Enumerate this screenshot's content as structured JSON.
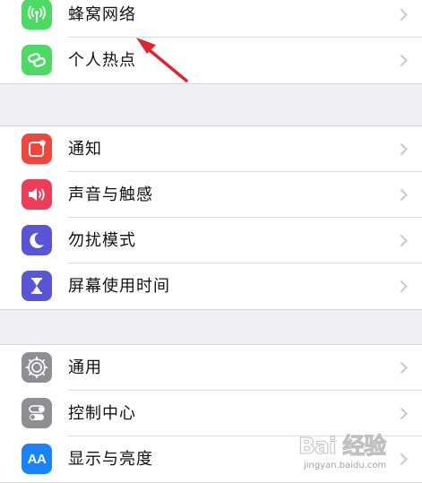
{
  "settings": {
    "group1": [
      {
        "label": "蜂窝网络",
        "icon": "cellular-antenna-icon",
        "color": "#4cd964"
      },
      {
        "label": "个人热点",
        "icon": "personal-hotspot-link-icon",
        "color": "#4cd964"
      }
    ],
    "group2": [
      {
        "label": "通知",
        "icon": "notifications-icon",
        "color": "#f0463c"
      },
      {
        "label": "声音与触感",
        "icon": "speaker-icon",
        "color": "#ee3c5a"
      },
      {
        "label": "勿扰模式",
        "icon": "moon-icon",
        "color": "#5856d6"
      },
      {
        "label": "屏幕使用时间",
        "icon": "hourglass-icon",
        "color": "#5856d6"
      }
    ],
    "group3": [
      {
        "label": "通用",
        "icon": "gear-icon",
        "color": "#8e8e93"
      },
      {
        "label": "控制中心",
        "icon": "toggle-switches-icon",
        "color": "#8e8e93"
      },
      {
        "label": "显示与亮度",
        "icon": "text-size-aa-icon",
        "color": "#1a82fb"
      }
    ]
  },
  "annotation": {
    "icon": "red-arrow-icon",
    "color": "#e0242c"
  },
  "watermark": {
    "logo": "Bai 经验",
    "url": "jingyan.baidu.com"
  },
  "icon_text": {
    "aa": "AA"
  }
}
